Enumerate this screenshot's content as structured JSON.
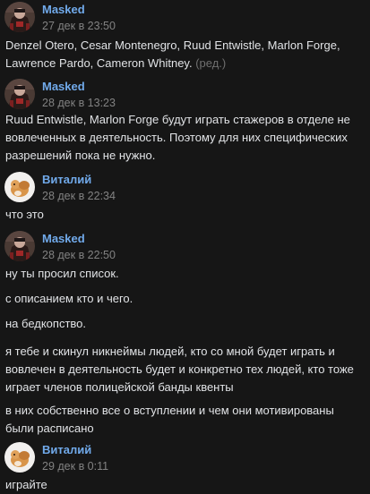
{
  "messages": [
    {
      "author": "Masked",
      "time": "27 дек в 23:50",
      "avatar": "masked-avatar",
      "paragraphs": [
        "Denzel Otero, Cesar Montenegro, Ruud Entwistle, Marlon Forge, Lawrence Pardo, Cameron Whitney."
      ],
      "edited": "(ред.)"
    },
    {
      "author": "Masked",
      "time": "28 дек в 13:23",
      "avatar": "masked-avatar",
      "paragraphs": [
        "Ruud Entwistle, Marlon Forge будут играть стажеров в отделе не вовлеченных в деятельность. Поэтому для них специфических разрешений пока не нужно."
      ]
    },
    {
      "author": "Виталий",
      "time": "28 дек в 22:34",
      "avatar": "vitaly-avatar",
      "paragraphs": [
        "что это"
      ]
    },
    {
      "author": "Masked",
      "time": "28 дек в 22:50",
      "avatar": "masked-avatar",
      "paragraphs": [
        "ну ты просил список.",
        "с описанием кто и чего.",
        "на бедкопство.",
        "я тебе и скинул никнеймы людей, кто со мной будет играть и вовлечен в деятельность будет и конкретно тех людей, кто тоже играет членов полицейской банды квенты",
        "в них собственно все о вступлении и чем они мотивированы были расписано"
      ]
    },
    {
      "author": "Виталий",
      "time": "29 дек в 0:11",
      "avatar": "vitaly-avatar",
      "paragraphs": [
        "играйте"
      ]
    }
  ],
  "colors": {
    "background": "#161616",
    "author": "#71aaeb",
    "time": "#828282",
    "text": "#e1e3e6"
  }
}
